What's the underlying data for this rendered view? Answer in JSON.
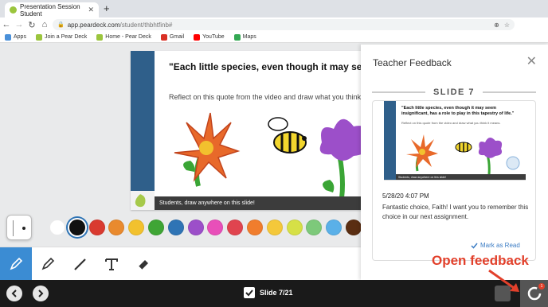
{
  "browser": {
    "tab_title": "Presentation Session Student",
    "tab_close": "✕",
    "new_tab": "+",
    "url_host": "app.peardeck.com",
    "url_path": "/student/thbhtfinb#",
    "bookmarks": [
      {
        "label": "Apps",
        "color": "#4a90d9"
      },
      {
        "label": "Join a Pear Deck",
        "color": "#9bc53d"
      },
      {
        "label": "Home - Pear Deck",
        "color": "#9bc53d"
      },
      {
        "label": "Gmail",
        "color": "#d93025"
      },
      {
        "label": "YouTube",
        "color": "#ff0000"
      },
      {
        "label": "Maps",
        "color": "#34a853"
      }
    ]
  },
  "slide": {
    "quote": "\"Each little species, even though it may seem insignificant, has a role to play in this tapestry of life.\"",
    "instruction": "Reflect on this quote from the video and draw what you think it means.",
    "footer": "Students, draw anywhere on this slide!"
  },
  "feedback": {
    "title": "Teacher Feedback",
    "close": "✕",
    "slide_label": "SLIDE 7",
    "thumb_quote": "\"Each little species, even though it may seem insignificant, has a role to play in this tapestry of life.\"",
    "thumb_instruction": "Reflect on this quote from the video and draw what you think it means.",
    "thumb_footer": "Students, draw anywhere on this slide!",
    "date": "5/28/20 4:07 PM",
    "message": "Fantastic choice, Faith! I want you to remember this choice in our next assignment.",
    "mark_read": "Mark as Read"
  },
  "palette": [
    "#ffffff",
    "#111111",
    "#d93a30",
    "#e98a2e",
    "#f2c12e",
    "#3fa535",
    "#2f74b5",
    "#9c4fc9",
    "#e84fb9",
    "#e0444f",
    "#f07d2d",
    "#f4c83a",
    "#d6e046",
    "#7dc97a",
    "#5ab0e8",
    "#5a2e12"
  ],
  "toolbar": {
    "tools": [
      "pen-tool",
      "marker-tool",
      "line-tool",
      "text-tool",
      "eraser-tool"
    ],
    "active_tool": "pen-tool"
  },
  "bottom": {
    "slide_counter": "Slide 7/21",
    "prev": "‹",
    "next": "›",
    "badge": "1"
  },
  "annotation": {
    "callout": "Open feedback"
  },
  "colors": {
    "accent": "#3b8cd3",
    "callout": "#e2402b",
    "link": "#3b7cc4"
  }
}
